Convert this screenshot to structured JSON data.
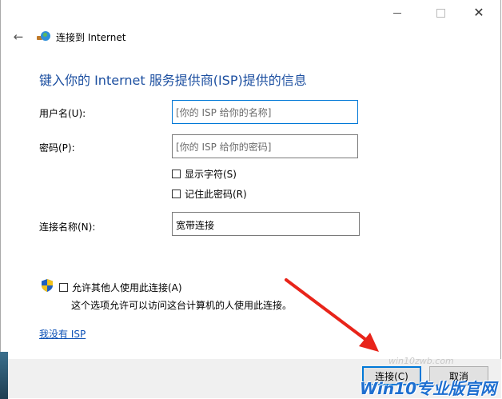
{
  "window": {
    "nav_title": "连接到 Internet"
  },
  "heading": "键入你的 Internet 服务提供商(ISP)提供的信息",
  "form": {
    "username_label": "用户名(U):",
    "username_placeholder": "[你的 ISP 给你的名称]",
    "password_label": "密码(P):",
    "password_placeholder": "[你的 ISP 给你的密码]",
    "show_chars_label": "显示字符(S)",
    "remember_label": "记住此密码(R)",
    "conn_name_label": "连接名称(N):",
    "conn_name_value": "宽带连接"
  },
  "sharing": {
    "allow_label": "允许其他人使用此连接(A)",
    "allow_note": "这个选项允许可以访问这台计算机的人使用此连接。"
  },
  "no_isp_link": "我没有 ISP",
  "buttons": {
    "connect": "连接(C)",
    "cancel": "取消"
  },
  "watermark": {
    "site": "win10zwb.com",
    "brand": "Win10专业版官网"
  },
  "icons": {
    "back": "back-arrow-icon",
    "network": "network-connection-icon",
    "shield": "uac-shield-icon"
  },
  "colors": {
    "heading": "#1c4fa0",
    "focus_border": "#0078d7",
    "link": "#0a4fb5",
    "annotation_arrow": "#e8241a"
  }
}
